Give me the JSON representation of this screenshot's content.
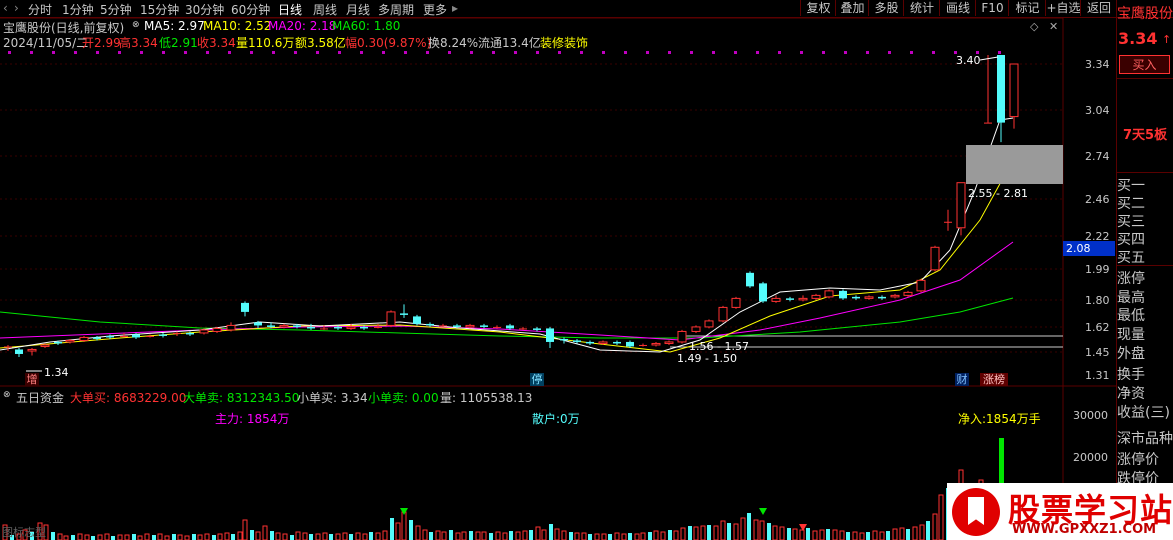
{
  "toolbar": {
    "periods": [
      "分时",
      "1分钟",
      "5分钟",
      "15分钟",
      "30分钟",
      "60分钟",
      "日线",
      "周线",
      "月线",
      "多周期",
      "更多"
    ],
    "active": "日线",
    "right_buttons": [
      "复权",
      "叠加",
      "多股",
      "统计",
      "画线",
      "F10",
      "标记",
      "+自选",
      "返回"
    ]
  },
  "header": {
    "title": "宝鹰股份(日线,前复权)",
    "ma5": "MA5: 2.97",
    "ma10": "MA10: 2.52",
    "ma20": "MA20: 2.18",
    "ma60": "MA60: 1.80",
    "date": "2024/11/05/二",
    "open": "开2.99",
    "high": "高3.34",
    "low": "低2.91",
    "close": "收3.34",
    "volume": "量110.6万",
    "amount": "额3.58亿",
    "change": "幅0.30(9.87%)",
    "turnover": "换8.24%",
    "float": "流通13.4亿",
    "industry": "装修装饰"
  },
  "price_axis": [
    "3.34",
    "3.04",
    "2.74",
    "2.46",
    "2.22",
    "1.99",
    "1.80",
    "1.62",
    "1.45",
    "1.31"
  ],
  "current_price_tag": "2.08",
  "annotations": {
    "high_mark": "3.40",
    "low_mark": "1.34",
    "gap_range": "2.55 - 2.81",
    "range1": "1.56 - 1.57",
    "range2": "1.49 - 1.50",
    "tag_zeng": "增",
    "tag_mid": "停",
    "tag_cai": "财",
    "tag_zhangbang": "涨榜"
  },
  "volume_panel": {
    "title": "五日资金",
    "big_buy": "大单买: 8683229.00",
    "big_sell": "大单卖: 8312343.50",
    "small_buy": "小单买: 3.34",
    "small_sell": "小单卖: 0.00",
    "vol": "量: 1105538.13",
    "main_force": "主力: 1854万",
    "retail": "散户:0万",
    "net_in": "净入:1854万手",
    "axis": [
      "30000",
      "20000"
    ],
    "bottom_text": "图标志型"
  },
  "sidebar": {
    "stock_name": "宝鹰股份",
    "price": "3.34",
    "buy_button": "买入",
    "streak": "7天5板",
    "order_labels": [
      "买一",
      "买二",
      "买三",
      "买四",
      "买五"
    ],
    "stats": [
      "涨停",
      "最高",
      "最低",
      "现量",
      "外盘",
      "换手",
      "净资",
      "收益(三)",
      "深市品种",
      "涨停价",
      "跌停价"
    ]
  },
  "watermark": {
    "brand": "股票学习站",
    "url": "WWW.GPXXZ1.COM"
  },
  "colors": {
    "up": "#ff3232",
    "down": "#54fcfc",
    "ma5": "#ffffff",
    "ma10": "#ffff00",
    "ma20": "#ff00ff",
    "ma60": "#00e600",
    "bg": "#000000"
  }
}
